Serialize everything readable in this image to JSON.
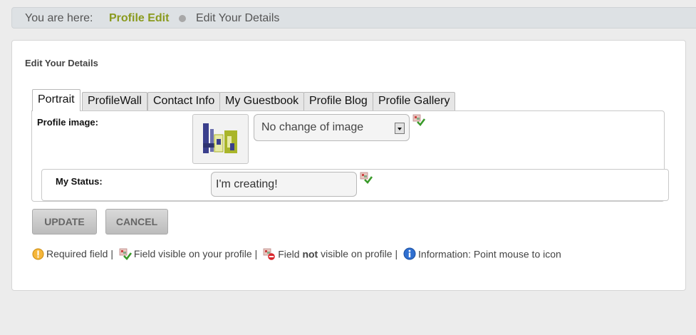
{
  "breadcrumb": {
    "prefix": "You are here:",
    "link": "Profile Edit",
    "current": "Edit Your Details"
  },
  "panel": {
    "title": "Edit Your Details"
  },
  "tabs": [
    {
      "label": "Portrait",
      "active": true
    },
    {
      "label": "ProfileWall",
      "active": false
    },
    {
      "label": "Contact Info",
      "active": false
    },
    {
      "label": "My Guestbook",
      "active": false
    },
    {
      "label": "Profile Blog",
      "active": false
    },
    {
      "label": "Profile Gallery",
      "active": false
    }
  ],
  "profile_image": {
    "label": "Profile image:",
    "select_value": "No change of image"
  },
  "status": {
    "label": "My Status:",
    "value": "I'm creating!"
  },
  "buttons": {
    "update": "UPDATE",
    "cancel": "CANCEL"
  },
  "legend": {
    "required": "Required field",
    "sep": "|",
    "visible": "Field visible on your profile",
    "not_visible_pre": "Field",
    "not_visible_bold": "not",
    "not_visible_post": "visible on profile",
    "info": "Information: Point mouse to icon"
  },
  "colors": {
    "breadcrumb_link": "#8a9a1e",
    "panel_bg": "#ffffff",
    "page_bg": "#ececec"
  },
  "icons": {
    "visible": "field-visible-icon",
    "not_visible": "field-not-visible-icon",
    "required": "required-icon",
    "info": "info-icon"
  }
}
